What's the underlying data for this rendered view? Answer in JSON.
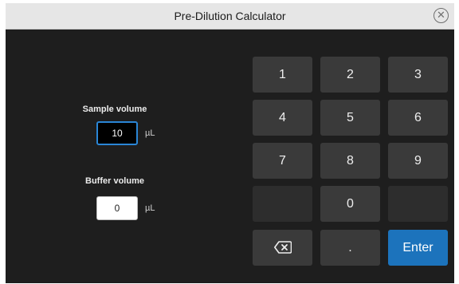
{
  "window": {
    "title": "Pre-Dilution Calculator",
    "close_glyph": "✕"
  },
  "sample": {
    "label": "Sample volume",
    "value": "10",
    "unit": "µL"
  },
  "buffer": {
    "label": "Buffer volume",
    "value": "0",
    "unit": "µL"
  },
  "keypad": {
    "k1": "1",
    "k2": "2",
    "k3": "3",
    "k4": "4",
    "k5": "5",
    "k6": "6",
    "k7": "7",
    "k8": "8",
    "k9": "9",
    "k0": "0",
    "dot": ".",
    "enter": "Enter",
    "backspace_icon": "backspace-icon"
  },
  "colors": {
    "accent": "#1c73bc",
    "focus_border": "#2a86d6",
    "key_bg": "#3a3a3a",
    "background": "#1e1e1e"
  }
}
